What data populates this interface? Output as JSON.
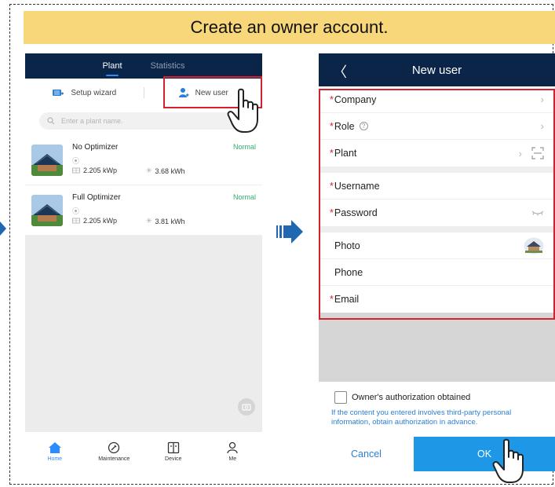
{
  "banner": {
    "title": "Create an owner account."
  },
  "left_phone": {
    "tabs": [
      {
        "label": "Plant",
        "active": true
      },
      {
        "label": "Statistics",
        "active": false
      }
    ],
    "actions": {
      "setup_wizard": "Setup wizard",
      "new_user": "New user"
    },
    "search": {
      "placeholder": "Enter a plant name."
    },
    "plants": [
      {
        "name": "No Optimizer",
        "capacity": "2.205 kWp",
        "energy": "3.68 kWh",
        "status": "Normal"
      },
      {
        "name": "Full Optimizer",
        "capacity": "2.205 kWp",
        "energy": "3.81 kWh",
        "status": "Normal"
      }
    ],
    "nav": [
      {
        "label": "Home",
        "icon": "home-icon",
        "active": true
      },
      {
        "label": "Maintenance",
        "icon": "maintenance-icon",
        "active": false
      },
      {
        "label": "Device",
        "icon": "device-icon",
        "active": false
      },
      {
        "label": "Me",
        "icon": "person-icon",
        "active": false
      }
    ]
  },
  "right_phone": {
    "title": "New user",
    "required_mark": "*",
    "fields": {
      "company": "Company",
      "role": "Role",
      "plant": "Plant",
      "username": "Username",
      "password": "Password",
      "photo": "Photo",
      "phone": "Phone",
      "email": "Email"
    },
    "consent_label": "Owner's authorization obtained",
    "notice": "If the content you entered involves third-party personal information, obtain authorization in advance.",
    "cancel_label": "Cancel",
    "ok_label": "OK"
  },
  "colors": {
    "banner": "#f8d67a",
    "header": "#0b2548",
    "highlight": "#d6202f",
    "accent": "#1d97e6",
    "status_normal": "#2fae6b"
  }
}
